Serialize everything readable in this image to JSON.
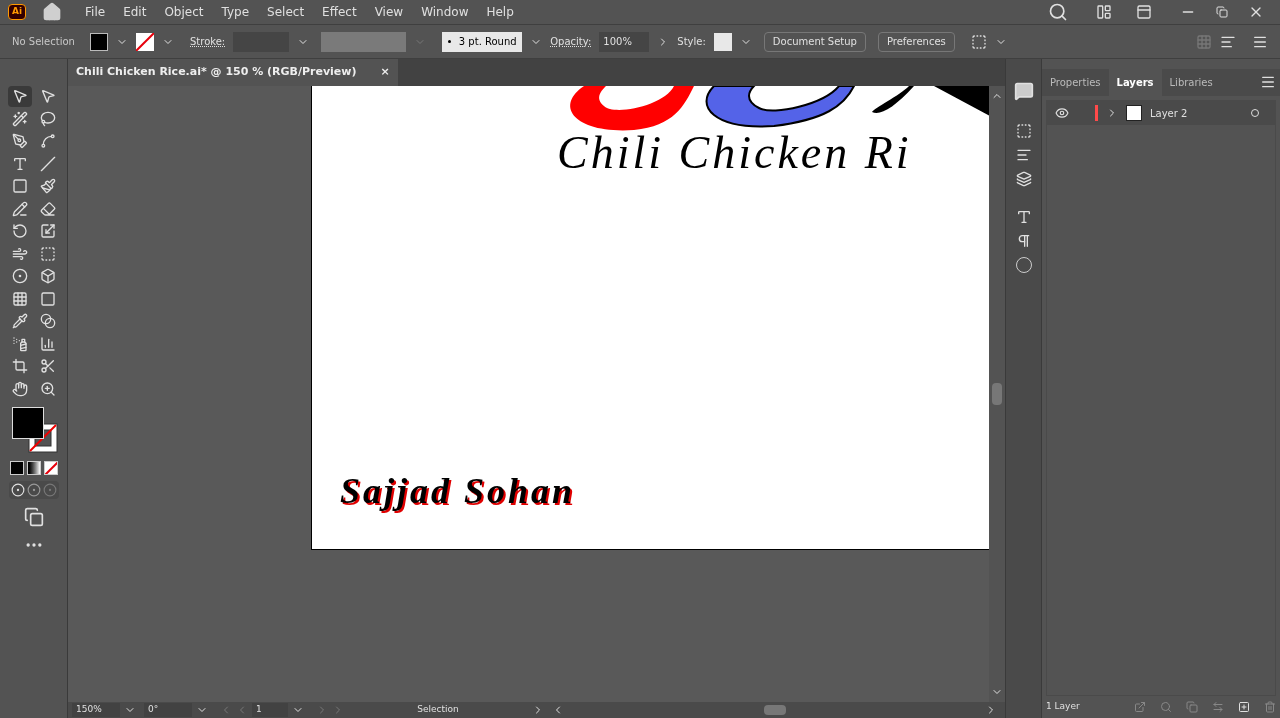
{
  "menu": [
    "File",
    "Edit",
    "Object",
    "Type",
    "Select",
    "Effect",
    "View",
    "Window",
    "Help"
  ],
  "app_badge": "Ai",
  "control_bar": {
    "selection": "No Selection",
    "stroke_label": "Stroke:",
    "brush": "3 pt. Round",
    "opacity_label": "Opacity:",
    "opacity": "100%",
    "style_label": "Style:",
    "buttons": [
      "Document Setup",
      "Preferences"
    ]
  },
  "tools": [
    {
      "kind": "select",
      "selected": true
    },
    {
      "kind": "direct",
      "selected": false
    },
    {
      "kind": "wand",
      "selected": false
    },
    {
      "kind": "lasso",
      "selected": false
    },
    {
      "kind": "pen",
      "selected": false
    },
    {
      "kind": "curvature",
      "selected": false
    },
    {
      "kind": "type",
      "selected": false
    },
    {
      "kind": "line",
      "selected": false
    },
    {
      "kind": "rect",
      "selected": false
    },
    {
      "kind": "brush",
      "selected": false
    },
    {
      "kind": "shaper",
      "selected": false
    },
    {
      "kind": "eraser",
      "selected": false
    },
    {
      "kind": "rotate",
      "selected": false
    },
    {
      "kind": "scale",
      "selected": false
    },
    {
      "kind": "warp",
      "selected": false
    },
    {
      "kind": "transform",
      "selected": false
    },
    {
      "kind": "shapebuilder",
      "selected": false
    },
    {
      "kind": "perspective",
      "selected": false
    },
    {
      "kind": "mesh",
      "selected": false
    },
    {
      "kind": "gradient",
      "selected": false
    },
    {
      "kind": "eyedropper",
      "selected": false
    },
    {
      "kind": "blend",
      "selected": false
    },
    {
      "kind": "symbol",
      "selected": false
    },
    {
      "kind": "graph",
      "selected": false
    },
    {
      "kind": "artboard",
      "selected": false
    },
    {
      "kind": "slice",
      "selected": false
    },
    {
      "kind": "hand",
      "selected": false
    },
    {
      "kind": "zoom",
      "selected": false
    }
  ],
  "document_tab": {
    "title": "Chili Chicken Rice.ai* @ 150 % (RGB/Preview)",
    "close": "×"
  },
  "artboard": {
    "title": "Chili Chicken Ri",
    "signature": "Sajjad Sohan"
  },
  "status_bar": {
    "zoom": "150%",
    "rotation": "0°",
    "artboard": "1",
    "tool": "Selection"
  },
  "panel": {
    "tabs": [
      {
        "label": "Properties",
        "selected": false
      },
      {
        "label": "Layers",
        "selected": true
      },
      {
        "label": "Libraries",
        "selected": false
      }
    ],
    "layers": [
      {
        "name": "Layer 2",
        "visible": true,
        "color": "#ff4a4a"
      }
    ],
    "footer": "1 Layer"
  }
}
